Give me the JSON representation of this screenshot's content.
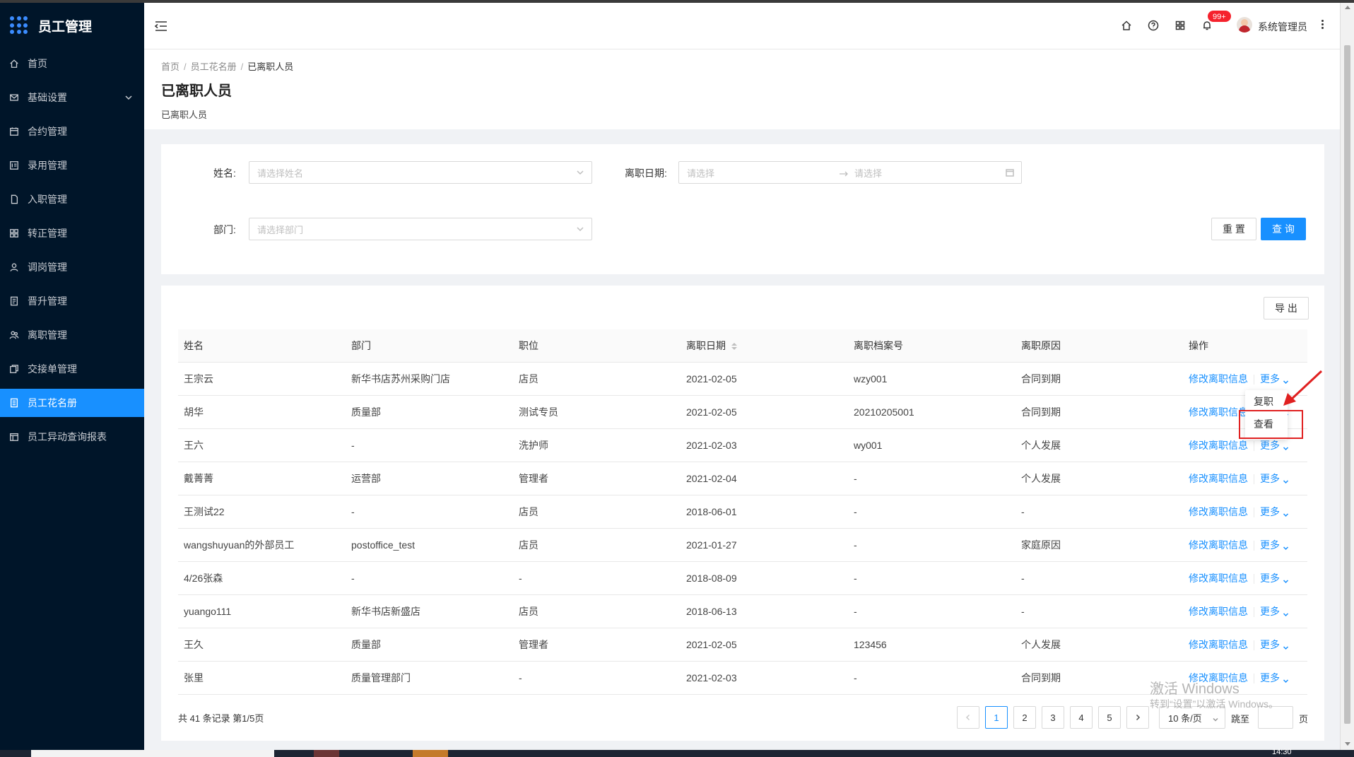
{
  "app": {
    "brand_title": "员工管理"
  },
  "sidebar": {
    "items": [
      {
        "label": "首页",
        "icon": "home-icon"
      },
      {
        "label": "基础设置",
        "icon": "mail-icon",
        "has_caret": true
      },
      {
        "label": "合约管理",
        "icon": "calendar-icon"
      },
      {
        "label": "录用管理",
        "icon": "idcard-icon"
      },
      {
        "label": "入职管理",
        "icon": "file-icon"
      },
      {
        "label": "转正管理",
        "icon": "grid-icon"
      },
      {
        "label": "调岗管理",
        "icon": "user-icon"
      },
      {
        "label": "晋升管理",
        "icon": "file-text-icon"
      },
      {
        "label": "离职管理",
        "icon": "team-icon"
      },
      {
        "label": "交接单管理",
        "icon": "copy-icon"
      },
      {
        "label": "员工花名册",
        "icon": "profile-icon",
        "active": true
      },
      {
        "label": "员工异动查询报表",
        "icon": "report-icon"
      }
    ]
  },
  "header": {
    "notification_count": "99+",
    "user_name": "系统管理员"
  },
  "page": {
    "breadcrumb": [
      "首页",
      "员工花名册",
      "已离职人员"
    ],
    "title": "已离职人员",
    "description": "已离职人员"
  },
  "search": {
    "name_label": "姓名:",
    "name_placeholder": "请选择姓名",
    "date_label": "离职日期:",
    "date_start_placeholder": "请选择",
    "date_end_placeholder": "请选择",
    "dept_label": "部门:",
    "dept_placeholder": "请选择部门",
    "reset_label": "重 置",
    "query_label": "查 询"
  },
  "table": {
    "export_label": "导 出",
    "columns": [
      "姓名",
      "部门",
      "职位",
      "离职日期",
      "离职档案号",
      "离职原因",
      "操作"
    ],
    "edit_link": "修改离职信息",
    "more_link": "更多",
    "rows": [
      {
        "name": "王宗云",
        "dept": "新华书店苏州采购门店",
        "position": "店员",
        "date": "2021-02-05",
        "archive": "wzy001",
        "reason": "合同到期"
      },
      {
        "name": "胡华",
        "dept": "质量部",
        "position": "测试专员",
        "date": "2021-02-05",
        "archive": "20210205001",
        "reason": "合同到期"
      },
      {
        "name": "王六",
        "dept": "-",
        "position": "洗护师",
        "date": "2021-02-03",
        "archive": "wy001",
        "reason": "个人发展"
      },
      {
        "name": "戴菁菁",
        "dept": "运营部",
        "position": "管理者",
        "date": "2021-02-04",
        "archive": "-",
        "reason": "个人发展"
      },
      {
        "name": "王测试22",
        "dept": "-",
        "position": "店员",
        "date": "2018-06-01",
        "archive": "-",
        "reason": "-"
      },
      {
        "name": "wangshuyuan的外部员工",
        "dept": "postoffice_test",
        "position": "店员",
        "date": "2021-01-27",
        "archive": "-",
        "reason": "家庭原因"
      },
      {
        "name": "4/26张森",
        "dept": "-",
        "position": "-",
        "date": "2018-08-09",
        "archive": "-",
        "reason": "-"
      },
      {
        "name": "yuango111",
        "dept": "新华书店新盛店",
        "position": "店员",
        "date": "2018-06-13",
        "archive": "-",
        "reason": "-"
      },
      {
        "name": "王久",
        "dept": "质量部",
        "position": "管理者",
        "date": "2021-02-05",
        "archive": "123456",
        "reason": "个人发展"
      },
      {
        "name": "张里",
        "dept": "质量管理部门",
        "position": "-",
        "date": "2021-02-03",
        "archive": "-",
        "reason": "合同到期"
      }
    ]
  },
  "dropdown": {
    "items": [
      "复职",
      "查看"
    ]
  },
  "pagination": {
    "total_text": "共 41 条记录 第1/5页",
    "pages": [
      "1",
      "2",
      "3",
      "4",
      "5"
    ],
    "current_page": "1",
    "page_size": "10 条/页",
    "goto_label": "跳至",
    "goto_suffix": "页"
  },
  "watermark": {
    "line1": "激活 Windows",
    "line2": "转到“设置”以激活 Windows。"
  },
  "taskbar": {
    "time": "14:30"
  },
  "colors": {
    "sidebar_bg": "#001529",
    "primary": "#1890ff",
    "highlight_red": "#e02020"
  }
}
